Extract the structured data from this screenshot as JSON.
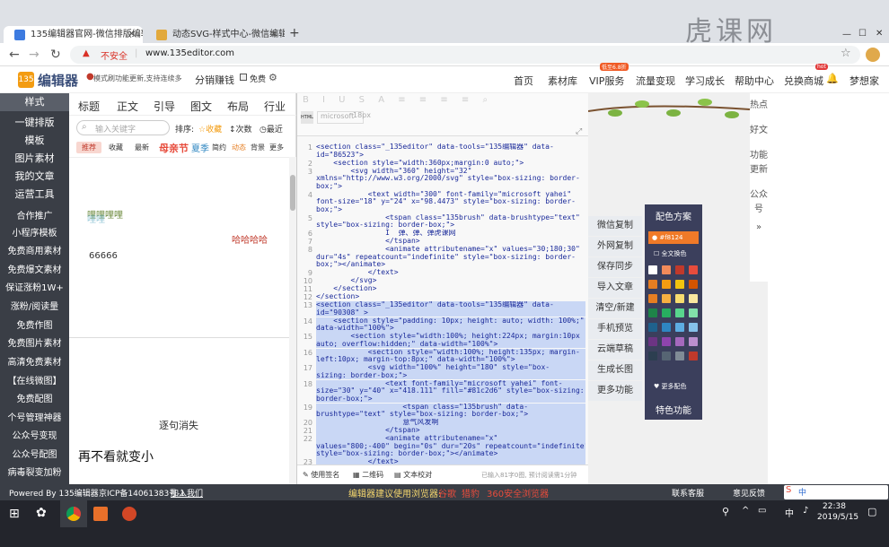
{
  "browser": {
    "tabs": [
      {
        "label": "135编辑器官网-微信排版编辑器"
      },
      {
        "label": "动态SVG-样式中心-微信编辑丰"
      }
    ],
    "url": "www.135editor.com",
    "security": "不安全",
    "watermark": "虎课网"
  },
  "site": {
    "logo": "编辑器",
    "announce": "模式刷功能更新,支持连续多 ",
    "share": "分销赚钱",
    "free_label": "免费",
    "nav": [
      {
        "label": "首页"
      },
      {
        "label": "素材库"
      },
      {
        "label": "VIP服务",
        "badge": "低至6.8折"
      },
      {
        "label": "流量变现"
      },
      {
        "label": "学习成长"
      },
      {
        "label": "帮助中心"
      },
      {
        "label": "兑换商城",
        "badge": "hot"
      }
    ],
    "user": "梦想家"
  },
  "sidebar": [
    {
      "label": "样式"
    },
    {
      "label": "一键排版"
    },
    {
      "label": "模板"
    },
    {
      "label": "图片素材"
    },
    {
      "label": "我的文章"
    },
    {
      "label": "运营工具"
    },
    {
      "label": "合作推广"
    },
    {
      "label": "小程序模板"
    },
    {
      "label": "免费商用素材"
    },
    {
      "label": "免费爆文素材"
    },
    {
      "label": "保证涨粉1W+"
    },
    {
      "label": "涨粉/阅读量"
    },
    {
      "label": "免费作图"
    },
    {
      "label": "免费图片素材"
    },
    {
      "label": "高清免费素材"
    },
    {
      "label": "【在线微图】"
    },
    {
      "label": "免费配图"
    },
    {
      "label": "个号管理神器"
    },
    {
      "label": "公众号变现"
    },
    {
      "label": "公众号配图"
    },
    {
      "label": "病毒裂变加粉"
    }
  ],
  "tools": {
    "cats": [
      "标题",
      "正文",
      "引导",
      "图文",
      "布局",
      "行业"
    ],
    "search_placeholder": "输入关键字",
    "sort_label": "排序:",
    "sort_options": [
      "收藏",
      "次数",
      "最近"
    ],
    "filters": [
      "推荐",
      "收藏",
      "最新",
      "母亲节",
      "夏季",
      "简约",
      "动态",
      "背景",
      "更多"
    ],
    "preview": {
      "t1": "哩哩哩哩",
      "t2": "哈哈哈哈",
      "t3": "66666",
      "t4": "逐句消失",
      "t5": "再不看就变小"
    }
  },
  "code": {
    "font": "microsoft",
    "size": "18px",
    "lines": [
      {
        "n": "1",
        "t": "<section class=\"_135editor\" data-tools=\"135编辑器\" data-\nid=\"86523\">"
      },
      {
        "n": "2",
        "t": "    <section style=\"width:360px;margin:0 auto;\">"
      },
      {
        "n": "3",
        "t": "        <svg width=\"360\" height=\"32\"\nxmlns=\"http://www.w3.org/2000/svg\" style=\"box-sizing: border-\nbox;\">"
      },
      {
        "n": "4",
        "t": "            <text width=\"300\" font-family=\"microsoft yahei\"\nfont-size=\"18\" y=\"24\" x=\"98.4473\" style=\"box-sizing: border-\nbox;\">"
      },
      {
        "n": "5",
        "t": "                <tspan class=\"135brush\" data-brushtype=\"text\"\nstyle=\"box-sizing: border-box;\">"
      },
      {
        "n": "6",
        "t": "                I  弹、弹、弹虎课网"
      },
      {
        "n": "7",
        "t": "                </tspan>"
      },
      {
        "n": "8",
        "t": "                <animate attributename=\"x\" values=\"30;180;30\"\ndur=\"4s\" repeatcount=\"indefinite\" style=\"box-sizing: border-\nbox;\"></animate>"
      },
      {
        "n": "9",
        "t": "            </text>"
      },
      {
        "n": "10",
        "t": "        </svg>"
      },
      {
        "n": "11",
        "t": "    </section>"
      },
      {
        "n": "12",
        "t": "</section>"
      },
      {
        "n": "13",
        "t": "<section class=\"_135editor\" data-tools=\"135编辑器\" data-\nid=\"90308\" >",
        "hl": true
      },
      {
        "n": "14",
        "t": "    <section style=\"padding: 10px; height: auto; width: 100%;\"\ndata-width=\"100%\">",
        "hl": true
      },
      {
        "n": "15",
        "t": "        <section style=\"width:100%; height:224px; margin:10px\nauto; overflow:hidden;\" data-width=\"100%\">",
        "hl": true
      },
      {
        "n": "16",
        "t": "            <section style=\"width:100%; height:135px; margin-\nleft:10px; margin-top:8px;\" data-width=\"100%\">",
        "hl": true
      },
      {
        "n": "17",
        "t": "            <svg width=\"100%\" height=\"180\" style=\"box-\nsizing: border-box;\">",
        "hl": true
      },
      {
        "n": "18",
        "t": "                <text font-family=\"microsoft yahei\" font-\nsize=\"30\" y=\"40\" x=\"418.111\" fill=\"#81c2d6\" style=\"box-sizing:\nborder-box;\">",
        "hl": true
      },
      {
        "n": "19",
        "t": "                    <tspan class=\"135brush\" data-\nbrushtype=\"text\" style=\"box-sizing: border-box;\">",
        "hl": true
      },
      {
        "n": "20",
        "t": "                    意气风发啊",
        "hl": true
      },
      {
        "n": "21",
        "t": "                </tspan>",
        "hl": true
      },
      {
        "n": "22",
        "t": "                <animate attributename=\"x\"\nvalues=\"800;-400\" begin=\"0s\" dur=\"20s\" repeatcount=\"indefinite\"\nstyle=\"box-sizing: border-box;\"></animate>",
        "hl": true
      },
      {
        "n": "23",
        "t": "            </text>",
        "hl": true
      },
      {
        "n": "24",
        "t": "            <text font-family=\"microsoft yahei\" font-\nsize=\"15\" y=\"75\" x=\"559.465\" fill=\"#8192d6\" style=\"box-sizing:",
        "hl": true
      }
    ],
    "footer": {
      "sign": "使用签名",
      "qr": "二维码",
      "proof": "文本校对",
      "count": "已输入81字0图, 预计阅读需1分钟"
    }
  },
  "actions": [
    "微信复制",
    "外网复制",
    "保存同步",
    "导入文章",
    "清空/新建",
    "手机预览",
    "云端草稿",
    "生成长图",
    "更多功能"
  ],
  "right_tabs": [
    "热点",
    "好文",
    "功能更新",
    "公众号"
  ],
  "color_panel": {
    "title": "配色方案",
    "current": "#f8124",
    "all": "全文换色",
    "more": "更多配色",
    "special": "特色功能",
    "swatches": [
      "#ffffff",
      "#f28b5a",
      "#c0392b",
      "#e74c3c",
      "#e67e22",
      "#f39c12",
      "#f1c40f",
      "#d35400",
      "#e67e22",
      "#f5b041",
      "#f7dc6f",
      "#f9e79f",
      "#1e8449",
      "#27ae60",
      "#58d68d",
      "#82e0aa",
      "#1f618d",
      "#2e86c1",
      "#5dade2",
      "#85c1e9",
      "#6c3483",
      "#8e44ad",
      "#a569bd",
      "#bb8fce",
      "#2c3e50",
      "#566573",
      "#808b96",
      "#c0392b"
    ]
  },
  "footer": {
    "powered": "Powered By 135编辑器",
    "icp": "京ICP备14061383号-1",
    "join": "加入我们",
    "browser_tip": "编辑器建议使用浏览器:",
    "b1": "谷歌",
    "b2": "猎豹",
    "b3": "360安全浏览器",
    "support": "联系客服",
    "feedback": "意见反馈"
  },
  "clock": {
    "time": "22:38",
    "date": "2019/5/15",
    "ime": "中"
  }
}
